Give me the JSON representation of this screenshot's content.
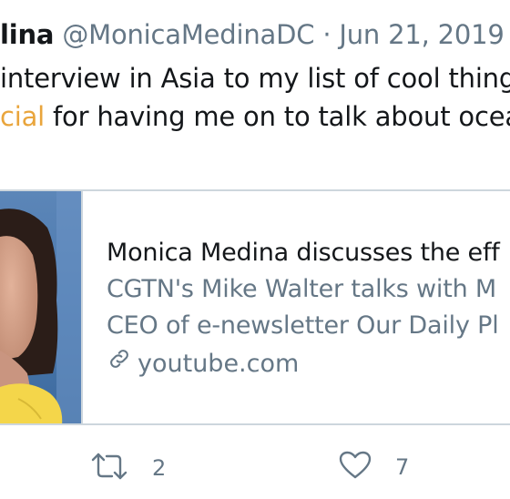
{
  "tweet": {
    "author_name_partial": "lina",
    "author_handle": "@MonicaMedinaDC",
    "separator": " · ",
    "date": "Jun 21, 2019",
    "line1": "interview in Asia to my list of cool things i",
    "line2_mention": "cial",
    "line2_rest": " for having me on to talk about oceans"
  },
  "card": {
    "title": "Monica Medina discusses the eff",
    "description_line1": "CGTN's Mike Walter talks with M",
    "description_line2": "CEO of e-newsletter Our Daily Pl",
    "domain": "youtube.com",
    "domain_icon": "link-icon"
  },
  "actions": {
    "retweet_icon": "retweet-icon",
    "retweet_count": "2",
    "like_icon": "heart-icon",
    "like_count": "7"
  },
  "colors": {
    "text": "#14171a",
    "secondary": "#657786",
    "mention": "#e9a53c",
    "border": "#cdd6dd",
    "thumb_yellow": "#f4d64a"
  }
}
